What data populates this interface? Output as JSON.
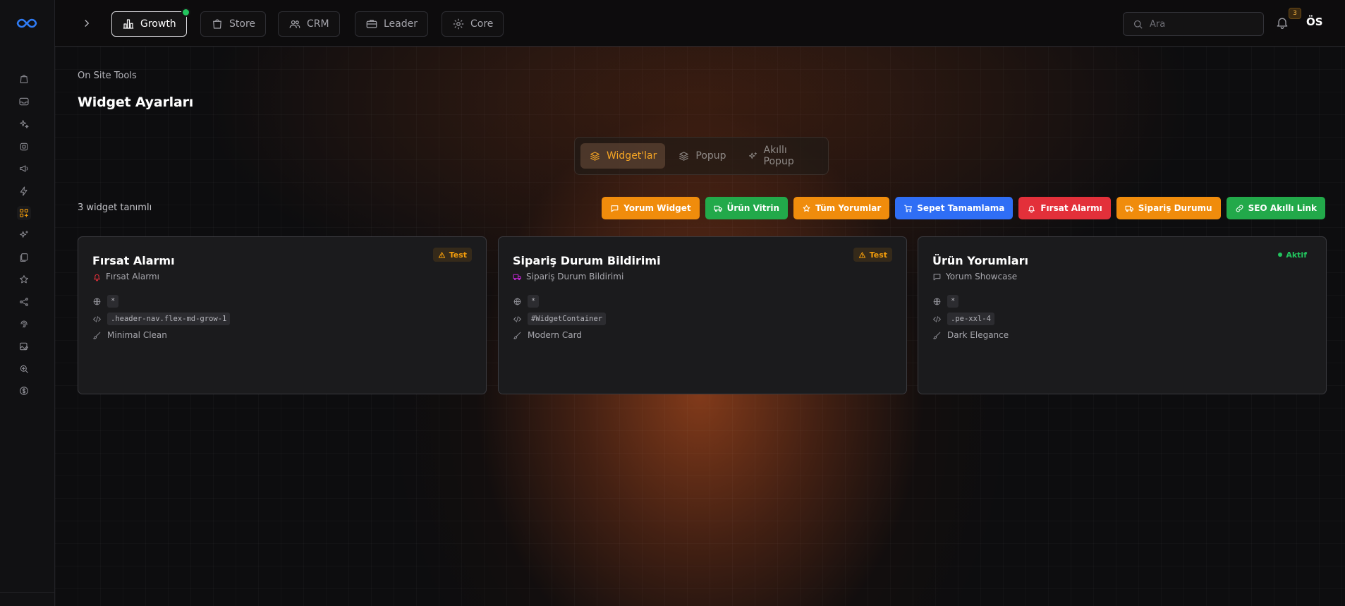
{
  "brand": {
    "logo_icon": "infinity-logo-icon",
    "accent": "#2563eb"
  },
  "topnav": {
    "tabs": [
      {
        "label": "Growth",
        "icon": "bar-chart-icon",
        "active": true
      },
      {
        "label": "Store",
        "icon": "shopping-bag-icon",
        "active": false
      },
      {
        "label": "CRM",
        "icon": "users-icon",
        "active": false
      },
      {
        "label": "Leader",
        "icon": "briefcase-icon",
        "active": false
      },
      {
        "label": "Core",
        "icon": "gear-icon",
        "active": false
      }
    ],
    "search_placeholder": "Ara",
    "notification_count": "3",
    "user_initials": "ÖS"
  },
  "sidebar": {
    "icons": [
      "shopping-bag-icon",
      "inbox-icon",
      "sparkles-icon",
      "chip-icon",
      "megaphone-icon",
      "bolt-icon",
      "apps-add-icon",
      "magic-icon",
      "files-icon",
      "star-icon",
      "share-icon",
      "fingerprint-icon",
      "image-edit-icon",
      "zoom-icon",
      "dollar-icon"
    ],
    "active_icon": "apps-add-icon"
  },
  "page": {
    "breadcrumb": "On Site Tools",
    "title": "Widget Ayarları"
  },
  "segment": {
    "items": [
      {
        "label": "Widget'lar",
        "icon": "layers-icon",
        "active": true
      },
      {
        "label": "Popup",
        "icon": "layers-icon",
        "active": false
      },
      {
        "label": "Akıllı Popup",
        "icon": "sparkles-icon",
        "active": false
      }
    ]
  },
  "widget_count": "3 widget tanımlı",
  "add_chips": [
    {
      "label": "Yorum Widget",
      "icon": "message-icon",
      "color": "#f08c0c"
    },
    {
      "label": "Ürün Vitrin",
      "icon": "truck-icon",
      "color": "#22a94a"
    },
    {
      "label": "Tüm Yorumlar",
      "icon": "star-icon",
      "color": "#f08c0c"
    },
    {
      "label": "Sepet Tamamlama",
      "icon": "cart-icon",
      "color": "#2f6ef5"
    },
    {
      "label": "Fırsat Alarmı",
      "icon": "alarm-icon",
      "color": "#e3303a"
    },
    {
      "label": "Sipariş Durumu",
      "icon": "truck-icon",
      "color": "#f08c0c"
    },
    {
      "label": "SEO Akıllı Link",
      "icon": "link-icon",
      "color": "#22a94a"
    }
  ],
  "cards": [
    {
      "title": "Fırsat Alarmı",
      "type": "Fırsat Alarmı",
      "type_icon": "alarm-icon",
      "type_color": "#e3303a",
      "status": "Test",
      "pages": "*",
      "selector": ".header-nav.flex-md-grow-1",
      "theme": "Minimal Clean"
    },
    {
      "title": "Sipariş Durum Bildirimi",
      "type": "Sipariş Durum Bildirimi",
      "type_icon": "truck-icon",
      "type_color": "#c026d3",
      "status": "Test",
      "pages": "*",
      "selector": "#WidgetContainer",
      "theme": "Modern Card"
    },
    {
      "title": "Ürün Yorumları",
      "type": "Yorum Showcase",
      "type_icon": "message-icon",
      "type_color": "#8e8e95",
      "status": "Aktif",
      "pages": "*",
      "selector": ".pe-xxl-4",
      "theme": "Dark Elegance"
    }
  ]
}
